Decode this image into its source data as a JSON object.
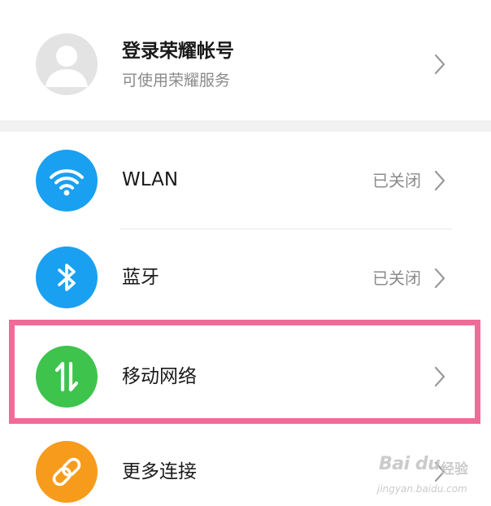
{
  "account": {
    "title": "登录荣耀帐号",
    "subtitle": "可使用荣耀服务"
  },
  "settings": [
    {
      "label": "WLAN",
      "status": "已关闭",
      "icon": "wifi-icon",
      "color": "#1aa0f0"
    },
    {
      "label": "蓝牙",
      "status": "已关闭",
      "icon": "bluetooth-icon",
      "color": "#1aa0f0"
    },
    {
      "label": "移动网络",
      "status": "",
      "icon": "mobile-data-icon",
      "color": "#3ec34d"
    },
    {
      "label": "更多连接",
      "status": "",
      "icon": "link-icon",
      "color": "#f79b1c"
    }
  ],
  "highlight": {
    "color": "#f06c98"
  },
  "watermark": {
    "brand": "Bai du",
    "text": "经验",
    "url": "jingyan.baidu.com"
  }
}
